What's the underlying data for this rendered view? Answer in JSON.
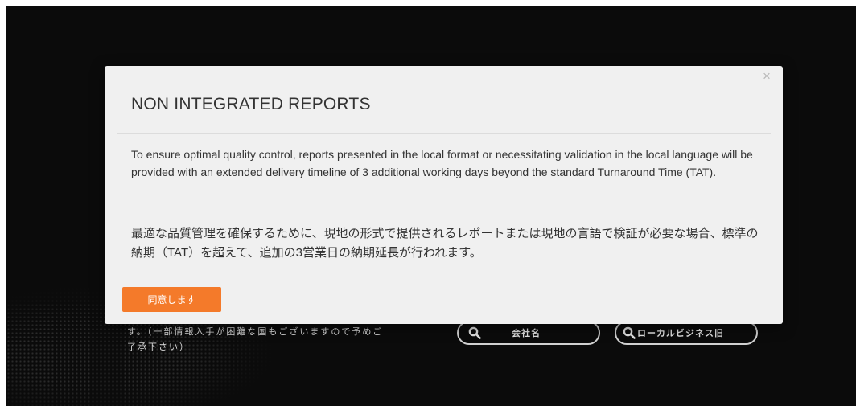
{
  "background": {
    "notice_text": "す。（一部情報入手が困難な国もございますので予めご了承下さい）",
    "search_buttons": {
      "company_label": "会社名",
      "local_label": "ローカルビジネス旧"
    }
  },
  "modal": {
    "title": "NON INTEGRATED REPORTS",
    "close_glyph": "×",
    "body_en": "To ensure optimal quality control, reports presented in the local format or necessitating validation in the local language will be provided with an extended delivery timeline of 3 additional working days beyond the standard Turnaround Time (TAT).",
    "body_ja": "最適な品質管理を確保するために、現地の形式で提供されるレポートまたは現地の言語で検証が必要な場合、標準の納期（TAT）を超えて、追加の3営業日の納期延長が行われます。",
    "agree_label": "同意します"
  },
  "colors": {
    "page_background": "#0b0b0b",
    "modal_background": "#f0f0f0",
    "accent": "#f47a2a",
    "text": "#333333"
  },
  "icons": {
    "close": "close-icon",
    "search": "search-icon"
  }
}
